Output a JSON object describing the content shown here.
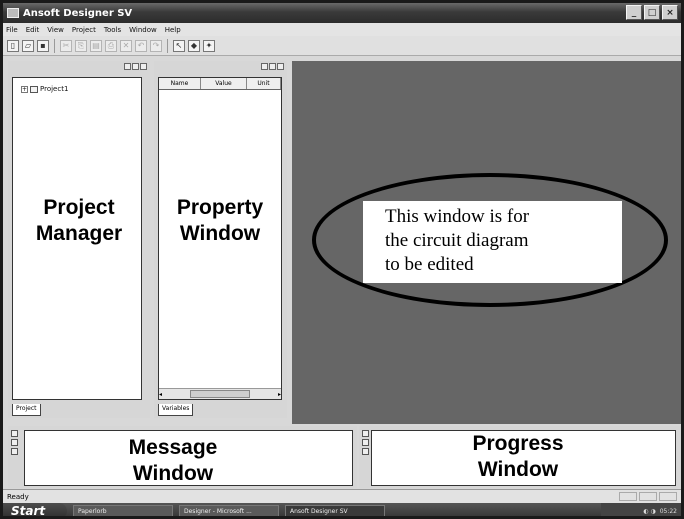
{
  "window": {
    "title": "Ansoft Designer SV"
  },
  "menu": [
    "File",
    "Edit",
    "View",
    "Project",
    "Tools",
    "Window",
    "Help"
  ],
  "toolbar_icons": [
    "new-icon",
    "open-icon",
    "save-icon",
    "cut-icon",
    "copy-icon",
    "paste-icon",
    "print-icon",
    "delete-icon",
    "undo-icon",
    "redo-icon",
    "wire-icon",
    "component-icon",
    "probe-icon"
  ],
  "project_manager": {
    "tree_root": "Project1",
    "tab": "Project",
    "label": "Project\nManager"
  },
  "property_window": {
    "columns": [
      "Name",
      "Value",
      "Unit"
    ],
    "tab": "Variables",
    "label": "Property\nWindow"
  },
  "drawing_area": {
    "annotation": "This window is for\nthe circuit diagram\nto be edited"
  },
  "message_window": {
    "label": "Message\nWindow"
  },
  "progress_window": {
    "label": "Progress\nWindow"
  },
  "statusbar": {
    "text": "Ready"
  },
  "taskbar": {
    "start": "Start",
    "tasks": [
      "Paperlorb",
      "Designer - Microsoft ...",
      "Ansoft Designer SV"
    ],
    "tray_time": "05:22"
  }
}
